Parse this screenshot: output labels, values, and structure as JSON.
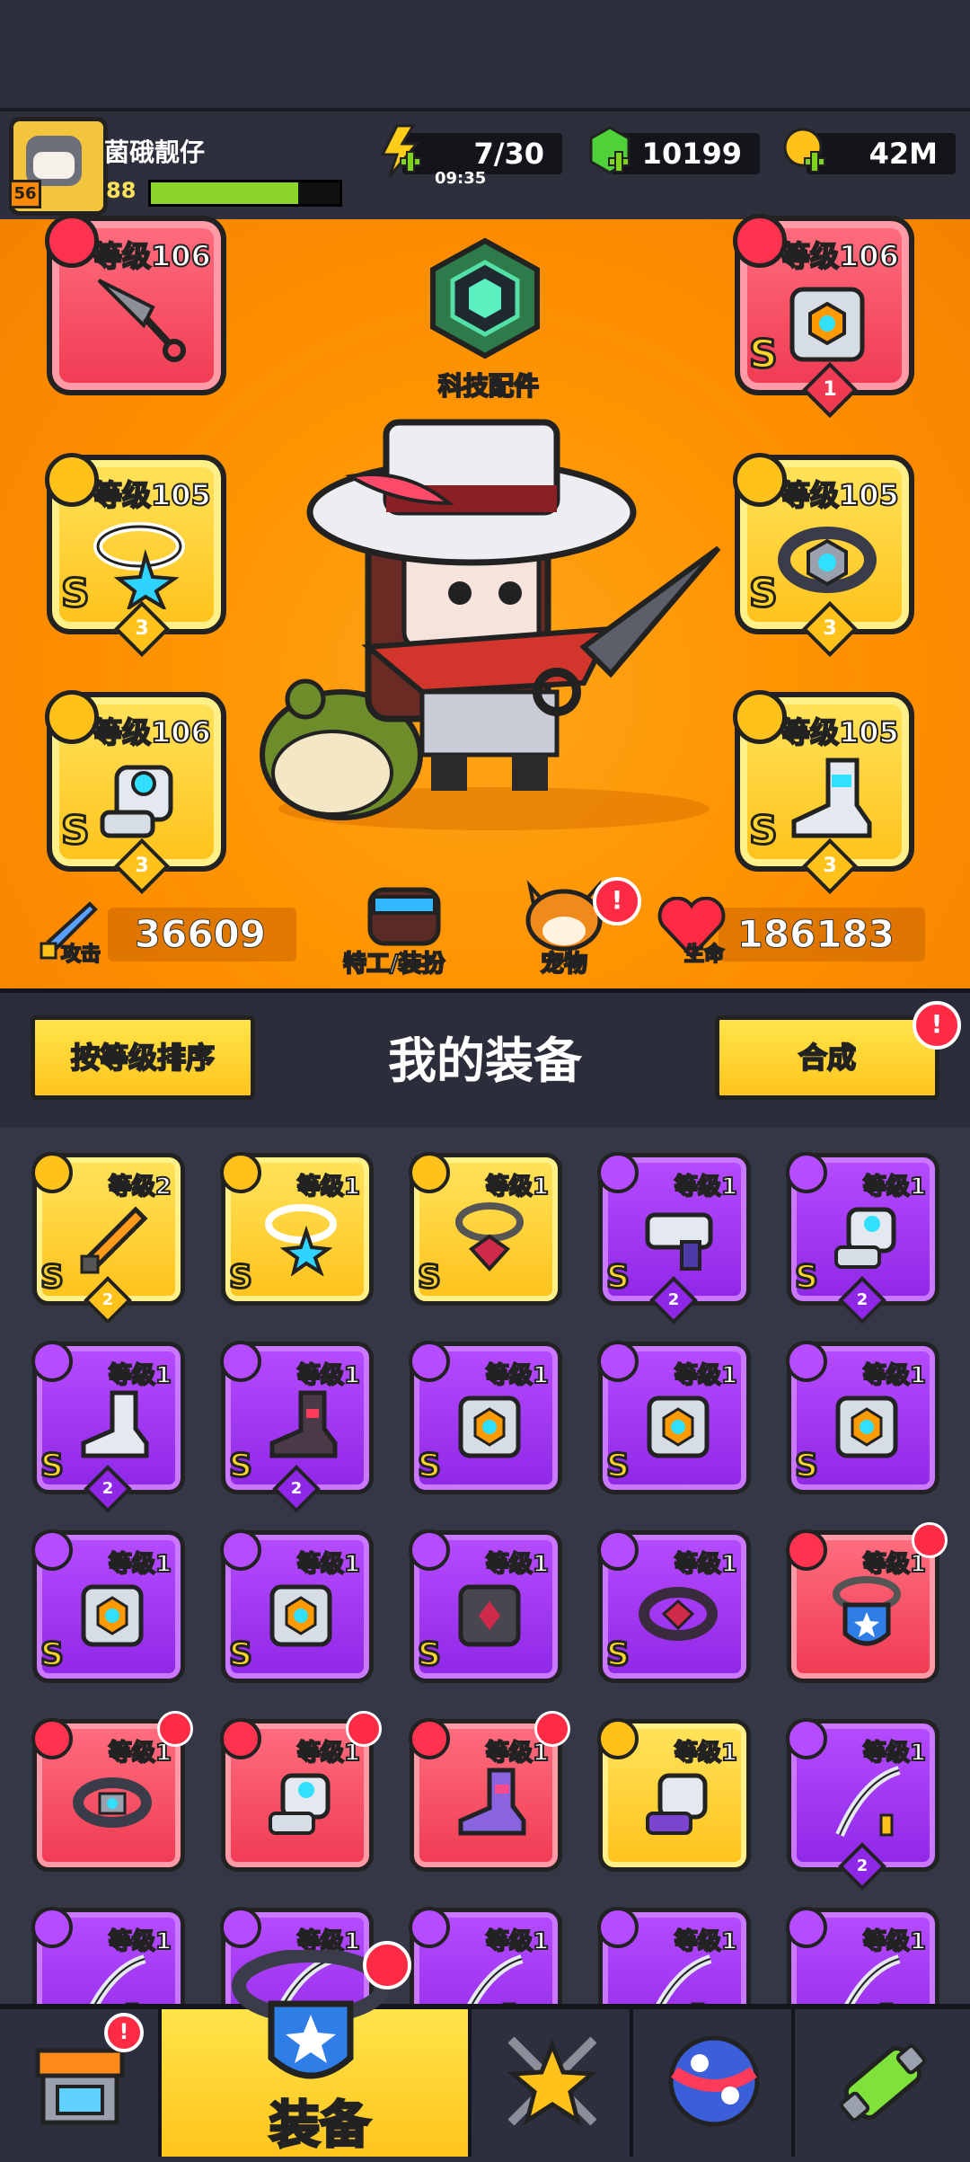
{
  "player": {
    "name": "菌硪靓仔",
    "level": "88",
    "avatar_level": "56",
    "xp_fraction": 0.78
  },
  "resources": {
    "energy": {
      "value": "7/30",
      "timer": "09:35",
      "icon": "lightning-icon"
    },
    "gems": {
      "value": "10199",
      "icon": "green-gem-icon"
    },
    "coins": {
      "value": "42M",
      "icon": "gold-coin-icon"
    }
  },
  "tech": {
    "label": "科技配件",
    "icon": "hexagon-gear-icon"
  },
  "equipped": {
    "weapon": {
      "level": "等级106",
      "rarity": "red",
      "icon": "kunai-icon"
    },
    "armor": {
      "level": "等级106",
      "grade": "S",
      "count": "1",
      "rarity": "red",
      "icon": "armor-vest-icon"
    },
    "necklace": {
      "level": "等级105",
      "grade": "S",
      "count": "3",
      "rarity": "yellow",
      "icon": "star-necklace-icon"
    },
    "belt": {
      "level": "等级105",
      "grade": "S",
      "count": "3",
      "rarity": "yellow",
      "icon": "belt-icon"
    },
    "gloves": {
      "level": "等级106",
      "grade": "S",
      "count": "3",
      "rarity": "yellow",
      "icon": "gauntlet-icon"
    },
    "boots": {
      "level": "等级105",
      "grade": "S",
      "count": "3",
      "rarity": "yellow",
      "icon": "boots-icon"
    }
  },
  "stats": {
    "attack": {
      "label": "攻击",
      "value": "36609"
    },
    "hp": {
      "label": "生命",
      "value": "186183"
    }
  },
  "hero_buttons": {
    "agent": "特工/装扮",
    "pet": "宠物",
    "pet_alert": "!"
  },
  "equipment_header": {
    "sort_button": "按等级排序",
    "title": "我的装备",
    "merge_button": "合成",
    "merge_alert": "!"
  },
  "inventory": [
    {
      "level": "等级2",
      "grade": "S",
      "count": "2",
      "rarity": "yellow",
      "art": "orange-sword"
    },
    {
      "level": "等级1",
      "grade": "S",
      "count": "",
      "rarity": "yellow",
      "art": "star-necklace"
    },
    {
      "level": "等级1",
      "grade": "S",
      "count": "",
      "rarity": "yellow",
      "art": "chain-necklace"
    },
    {
      "level": "等级1",
      "grade": "S",
      "count": "2",
      "rarity": "purple",
      "art": "blaster-gun"
    },
    {
      "level": "等级1",
      "grade": "S",
      "count": "2",
      "rarity": "purple",
      "art": "gauntlet"
    },
    {
      "level": "等级1",
      "grade": "S",
      "count": "2",
      "rarity": "purple",
      "art": "boots"
    },
    {
      "level": "等级1",
      "grade": "S",
      "count": "2",
      "rarity": "purple",
      "art": "dark-boots"
    },
    {
      "level": "等级1",
      "grade": "S",
      "count": "",
      "rarity": "purple",
      "art": "armor-vest"
    },
    {
      "level": "等级1",
      "grade": "S",
      "count": "",
      "rarity": "purple",
      "art": "armor-vest"
    },
    {
      "level": "等级1",
      "grade": "S",
      "count": "",
      "rarity": "purple",
      "art": "armor-vest"
    },
    {
      "level": "等级1",
      "grade": "S",
      "count": "",
      "rarity": "purple",
      "art": "armor-vest"
    },
    {
      "level": "等级1",
      "grade": "S",
      "count": "",
      "rarity": "purple",
      "art": "armor-vest"
    },
    {
      "level": "等级1",
      "grade": "S",
      "count": "",
      "rarity": "purple",
      "art": "dark-armor"
    },
    {
      "level": "等级1",
      "grade": "S",
      "count": "",
      "rarity": "purple",
      "art": "dark-belt"
    },
    {
      "level": "等级1",
      "grade": "",
      "count": "",
      "rarity": "red",
      "art": "shield-necklace",
      "new": true
    },
    {
      "level": "等级1",
      "grade": "",
      "count": "",
      "rarity": "red",
      "art": "belt",
      "new": true
    },
    {
      "level": "等级1",
      "grade": "",
      "count": "",
      "rarity": "red",
      "art": "gauntlet",
      "new": true
    },
    {
      "level": "等级1",
      "grade": "",
      "count": "",
      "rarity": "red",
      "art": "purple-boots",
      "new": true
    },
    {
      "level": "等级1",
      "grade": "",
      "count": "",
      "rarity": "yellow",
      "art": "purple-gauntlet"
    },
    {
      "level": "等级1",
      "grade": "",
      "count": "2",
      "rarity": "purple",
      "art": "katana"
    },
    {
      "level": "等级1",
      "grade": "",
      "count": "",
      "rarity": "purple",
      "art": "katana"
    },
    {
      "level": "等级1",
      "grade": "",
      "count": "",
      "rarity": "purple",
      "art": "katana"
    },
    {
      "level": "等级1",
      "grade": "",
      "count": "",
      "rarity": "purple",
      "art": "katana"
    },
    {
      "level": "等级1",
      "grade": "",
      "count": "",
      "rarity": "purple",
      "art": "katana"
    },
    {
      "level": "等级1",
      "grade": "",
      "count": "",
      "rarity": "purple",
      "art": "katana"
    }
  ],
  "nav": {
    "shop": {
      "icon": "shop-icon",
      "alert": "!"
    },
    "equipment": {
      "label": "装备",
      "icon": "shield-necklace-icon"
    },
    "battle": {
      "icon": "crossed-swords-star-icon"
    },
    "events": {
      "icon": "star-ball-icon"
    },
    "lab": {
      "icon": "dna-capsule-icon"
    }
  }
}
